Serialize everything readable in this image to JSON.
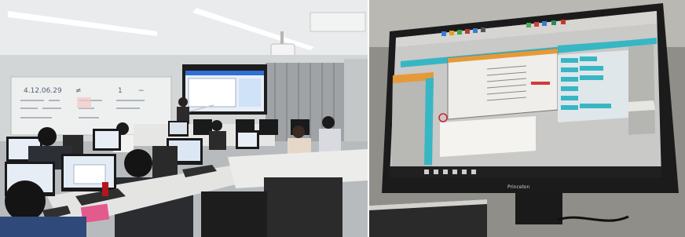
{
  "photos": [
    {
      "scene": "classroom",
      "whiteboard": {
        "lines": [
          "4.12.06.29",
          "≠",
          "1",
          "−"
        ]
      }
    },
    {
      "scene": "monitor",
      "monitor": {
        "brand": "Princeton"
      }
    }
  ],
  "colors": {
    "ceiling": "#e9ebec",
    "wall": "#d3d6d6",
    "whiteboard": "#eef0ef",
    "projector_screen": "#2f6fd6",
    "monitor_bezel": "#1b1b1b",
    "app_background": "#c9c9c7",
    "app_teal": "#37b6c4"
  }
}
